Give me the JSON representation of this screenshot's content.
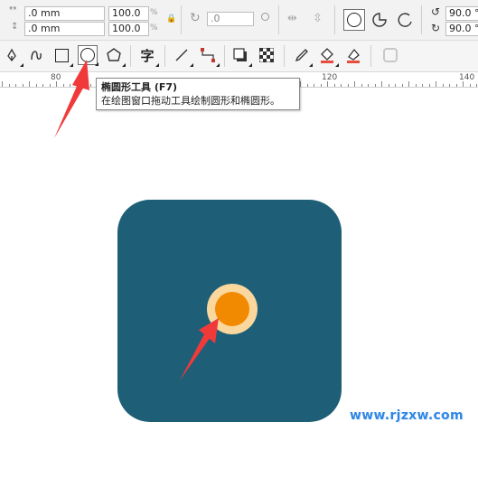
{
  "propbar": {
    "x_value": ".0 mm",
    "y_value": ".0 mm",
    "scale_x": "100.0",
    "scale_y": "100.0",
    "percent_unit": "%",
    "rotation": ".0",
    "start_angle": "90.0 °",
    "end_angle": "90.0 °"
  },
  "toolbar": {
    "text_tool_glyph": "字",
    "tooltip_title": "椭圆形工具 (F7)",
    "tooltip_desc": "在绘图窗口拖动工具绘制圆形和椭圆形。"
  },
  "ruler": {
    "labels": [
      "80",
      "120",
      "140"
    ]
  },
  "watermark": "www.rjzxw.com",
  "colors": {
    "square": "#1e5f77",
    "circle_fill": "#f18a00",
    "circle_outline": "#f9d79d",
    "arrow": "#f03a3a",
    "watermark": "#2f86e3"
  }
}
